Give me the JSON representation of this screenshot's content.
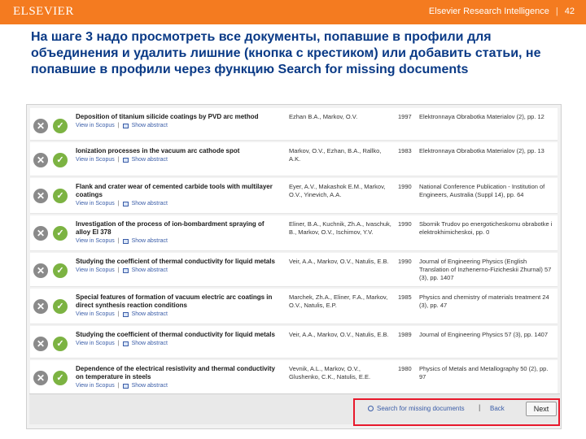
{
  "header": {
    "brand": "ELSEVIER",
    "product": "Elsevier Research Intelligence",
    "separator": "|",
    "page_number": "42"
  },
  "slide": {
    "title": "На шаге 3 надо просмотреть все документы, попавшие в профили для объединения и удалить лишние (кнопка с крестиком) или добавить статьи, не попавшие в профили через функцию Search for missing documents"
  },
  "actions": {
    "remove_glyph": "✕",
    "keep_glyph": "✓",
    "view_label": "View in Scopus",
    "abstract_label": "Show abstract",
    "link_sep": "|"
  },
  "documents": [
    {
      "title": "Deposition of titanium silicide coatings by PVD arc method",
      "authors": "Ezhan B.A., Markov, O.V.",
      "year": "1997",
      "source": "Elektronnaya Obrabotka Materialov (2), pp. 12"
    },
    {
      "title": "Ionization processes in the vacuum arc cathode spot",
      "authors": "Markov, O.V., Ezhan, B.A., Rallko, A.K.",
      "year": "1983",
      "source": "Elektronnaya Obrabotka Materialov (2), pp. 13"
    },
    {
      "title": "Flank and crater wear of cemented carbide tools with multilayer coatings",
      "authors": "Eyer, A.V., Makashok E.M., Markov, O.V., Yinevich, A.A.",
      "year": "1990",
      "source": "National Conference Publication - Institution of Engineers, Australia (Suppl 14), pp. 64"
    },
    {
      "title": "Investigation of the process of ion-bombardment spraying of alloy EI 378",
      "authors": "Eliner, B.A., Kuchnik, Zh.A., Ivaschuk, B., Markov, O.V., Ischimov, Y.V.",
      "year": "1990",
      "source": "Sbornik Trudov po energoticheskomu obrabotke i elektrokhimicheskoi, pp. 0"
    },
    {
      "title": "Studying the coefficient of thermal conductivity for liquid metals",
      "authors": "Veir, A.A., Markov, O.V., Natulis, E.B.",
      "year": "1990",
      "source": "Journal of Engineering Physics (English Translation of Inzhenerno-Fizicheskii Zhurnal) 57 (3), pp. 1407"
    },
    {
      "title": "Special features of formation of vacuum electric arc coatings in direct synthesis reaction conditions",
      "authors": "Marchek, Zh.A., Eliner, F.A., Markov, O.V., Natulis, E.P.",
      "year": "1985",
      "source": "Physics and chemistry of materials treatment 24 (3), pp. 47"
    },
    {
      "title": "Studying the coefficient of thermal conductivity for liquid metals",
      "authors": "Veir, A.A., Markov, O.V., Natulis, E.B.",
      "year": "1989",
      "source": "Journal of Engineering Physics 57 (3), pp. 1407"
    },
    {
      "title": "Dependence of the electrical resistivity and thermal conductivity on temperature in steels",
      "authors": "Vevnik, A.L., Markov, O.V., Glushenko, C.K., Natulis, E.E.",
      "year": "1980",
      "source": "Physics of Metals and Metallography 50 (2), pp. 97"
    }
  ],
  "footer": {
    "search_missing": "Search for missing documents",
    "separator": "|",
    "back": "Back",
    "next": "Next"
  },
  "colors": {
    "header": "#f47b20",
    "title": "#0a3a86",
    "highlight": "#e8192c",
    "keep": "#7cb342",
    "remove": "#8a8a8a"
  }
}
